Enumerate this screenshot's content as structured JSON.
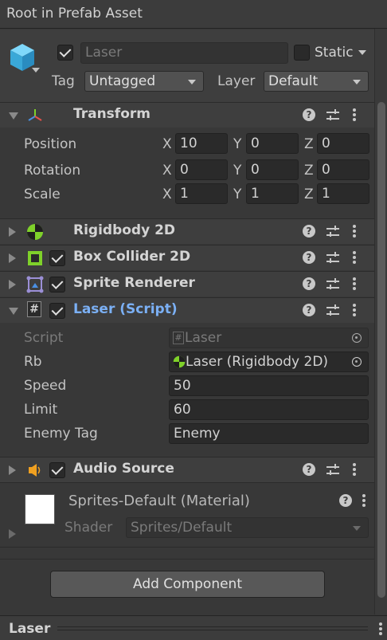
{
  "window": {
    "title": "Root in Prefab Asset"
  },
  "gameobject": {
    "name_placeholder": "Laser",
    "static_label": "Static",
    "tag_label": "Tag",
    "tag_value": "Untagged",
    "layer_label": "Layer",
    "layer_value": "Default"
  },
  "transform": {
    "title": "Transform",
    "rows": [
      {
        "label": "Position",
        "x": "10",
        "y": "0",
        "z": "0"
      },
      {
        "label": "Rotation",
        "x": "0",
        "y": "0",
        "z": "0"
      },
      {
        "label": "Scale",
        "x": "1",
        "y": "1",
        "z": "1"
      }
    ],
    "axis_x": "X",
    "axis_y": "Y",
    "axis_z": "Z"
  },
  "components": {
    "rigidbody": "Rigidbody 2D",
    "boxcollider": "Box Collider 2D",
    "sprite_renderer": "Sprite Renderer",
    "laser_script": "Laser (Script)",
    "audio_source": "Audio Source"
  },
  "script_fields": {
    "script_label": "Script",
    "script_value": "Laser",
    "rb_label": "Rb",
    "rb_value": "Laser (Rigidbody 2D)",
    "speed_label": "Speed",
    "speed_value": "50",
    "limit_label": "Limit",
    "limit_value": "60",
    "enemy_tag_label": "Enemy Tag",
    "enemy_tag_value": "Enemy"
  },
  "material": {
    "name": "Sprites-Default (Material)",
    "shader_label": "Shader",
    "shader_value": "Sprites/Default"
  },
  "add_component": "Add Component",
  "footer": {
    "title": "Laser"
  },
  "icons": {
    "question": "?",
    "script_hash": "#"
  },
  "colors": {
    "accent_blue": "#7bb0f5",
    "rigidbody_green": "#7fd12a",
    "audio_orange": "#f0a020",
    "cube_blue": "#4fc3f7"
  }
}
